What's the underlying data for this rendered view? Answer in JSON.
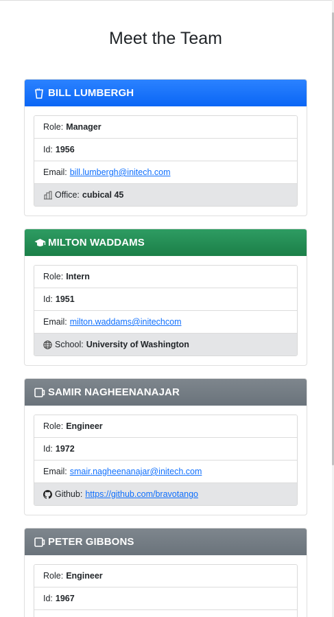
{
  "page": {
    "title": "Meet the Team"
  },
  "cards": [
    {
      "name": "BILL LUMBERGH",
      "icon": "coffee-cup-icon",
      "header_color": "#0d6efd",
      "role_label": "Role:",
      "role": "Manager",
      "id_label": "Id:",
      "id": "1956",
      "email_label": "Email:",
      "email": "bill.lumbergh@initech.com",
      "extra_icon": "building-icon",
      "extra_label": "Office:",
      "extra_value": "cubical 45"
    },
    {
      "name": "MILTON WADDAMS",
      "icon": "graduation-cap-icon",
      "header_color": "#198754",
      "role_label": "Role:",
      "role": "Intern",
      "id_label": "Id:",
      "id": "1951",
      "email_label": "Email:",
      "email": "milton.waddams@initechcom",
      "extra_icon": "globe-icon",
      "extra_label": "School:",
      "extra_value": "University of Washington"
    },
    {
      "name": "SAMIR NAGHEENANAJAR",
      "icon": "mug-icon",
      "header_color": "#6c757d",
      "role_label": "Role:",
      "role": "Engineer",
      "id_label": "Id:",
      "id": "1972",
      "email_label": "Email:",
      "email": "smair.nagheenanajar@initech.com",
      "extra_icon": "github-icon",
      "extra_label": "Github:",
      "extra_value": "https://github.com/bravotango"
    },
    {
      "name": "PETER GIBBONS",
      "icon": "mug-icon",
      "header_color": "#6c757d",
      "role_label": "Role:",
      "role": "Engineer",
      "id_label": "Id:",
      "id": "1967"
    }
  ]
}
